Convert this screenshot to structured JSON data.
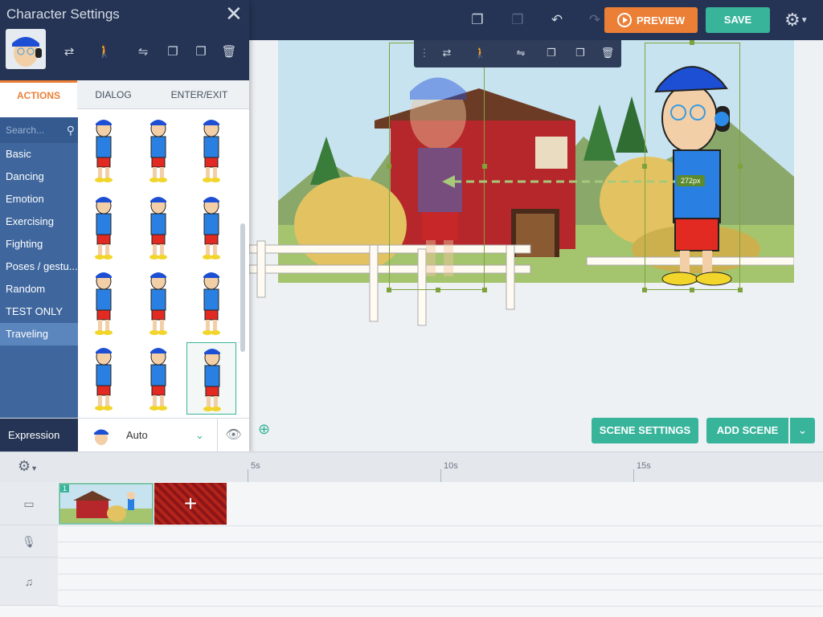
{
  "topbar": {
    "icons": [
      "copy-icon",
      "paste-icon",
      "undo-icon",
      "redo-icon"
    ],
    "preview_label": "PREVIEW",
    "save_label": "SAVE",
    "settings_icon": "gear-icon"
  },
  "panel": {
    "title": "Character Settings",
    "close_glyph": "✕",
    "tabs": [
      "ACTIONS",
      "DIALOG",
      "ENTER/EXIT"
    ],
    "active_tab": "ACTIONS",
    "search_placeholder": "Search...",
    "categories": [
      "Basic",
      "Dancing",
      "Emotion",
      "Exercising",
      "Fighting",
      "Poses / gestu...",
      "Random",
      "TEST ONLY",
      "Traveling"
    ],
    "selected_category": "Traveling",
    "expression_label": "Expression",
    "expression_value": "Auto"
  },
  "stage": {
    "distance_label": "272px",
    "scene_settings_label": "SCENE SETTINGS",
    "add_scene_label": "ADD SCENE"
  },
  "timeline": {
    "ticks": [
      "5s",
      "10s",
      "15s"
    ],
    "scene_number": "1",
    "add_glyph": "+",
    "row_icons": [
      "camera-icon",
      "microphone-icon",
      "music-icon"
    ]
  },
  "colors": {
    "navy": "#253454",
    "teal": "#38b49b",
    "orange": "#ec7f36",
    "category_blue": "#3f679e"
  }
}
